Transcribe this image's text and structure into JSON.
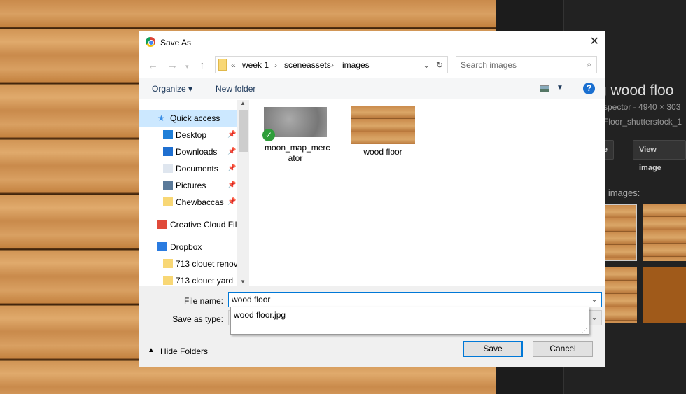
{
  "background": {
    "title": "g wood floo",
    "subtitle": "spector - 4940 × 303",
    "filename": "Floor_shutterstock_1",
    "buttons": [
      "age",
      "View image"
    ],
    "related": "d images:"
  },
  "dialog": {
    "title": "Save As",
    "close": "✕",
    "breadcrumb": [
      "«",
      "week 1",
      "sceneassets",
      "images"
    ],
    "search_placeholder": "Search images",
    "toolbar": {
      "organize": "Organize ▾",
      "new_folder": "New folder",
      "help": "?"
    },
    "sidebar": [
      {
        "label": "Quick access",
        "icon": "star-icon",
        "pinned": false
      },
      {
        "label": "Desktop",
        "icon": "desktop-icon",
        "pinned": true
      },
      {
        "label": "Downloads",
        "icon": "download-icon",
        "pinned": true
      },
      {
        "label": "Documents",
        "icon": "document-icon",
        "pinned": true
      },
      {
        "label": "Pictures",
        "icon": "pictures-icon",
        "pinned": true
      },
      {
        "label": "Chewbaccas",
        "icon": "folder-icon",
        "pinned": true
      },
      {
        "label": "Creative Cloud Fil",
        "icon": "creative-cloud-icon",
        "pinned": false
      },
      {
        "label": "Dropbox",
        "icon": "dropbox-icon",
        "pinned": false
      },
      {
        "label": "713 clouet renov",
        "icon": "folder-icon",
        "pinned": false
      },
      {
        "label": "713 clouet yard",
        "icon": "folder-icon",
        "pinned": false
      }
    ],
    "files": [
      {
        "name": "moon_map_merc ator"
      },
      {
        "name": "wood floor"
      }
    ],
    "file_name_label": "File name:",
    "file_name_value": "wood floor",
    "save_type_label": "Save as type:",
    "suggestion": "wood floor.jpg",
    "hide_folders": "Hide Folders",
    "save": "Save",
    "cancel": "Cancel"
  },
  "colors": {
    "accent": "#0078d7",
    "dark_bg": "#1c1c1c"
  }
}
